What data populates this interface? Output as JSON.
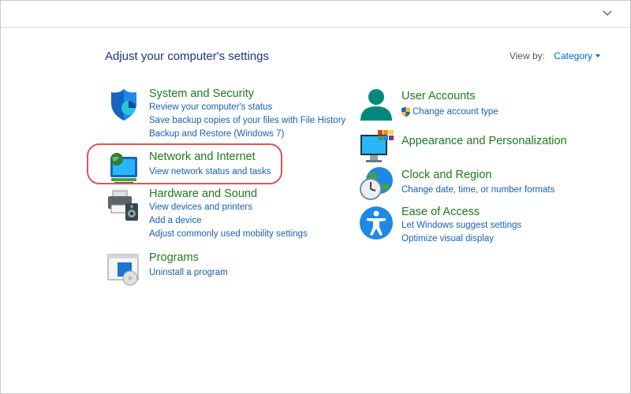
{
  "window": {
    "heading": "Adjust your computer's settings",
    "view_by_label": "View by:",
    "view_by_value": "Category",
    "dropdown_icon": "chevron-down-icon"
  },
  "left_column": [
    {
      "title": "System and Security",
      "icon": "shield-icon",
      "links": [
        "Review your computer's status",
        "Save backup copies of your files with File History",
        "Backup and Restore (Windows 7)"
      ]
    },
    {
      "title": "Network and Internet",
      "icon": "network-globe-icon",
      "highlighted": true,
      "links": [
        "View network status and tasks"
      ]
    },
    {
      "title": "Hardware and Sound",
      "icon": "printer-speaker-icon",
      "links": [
        "View devices and printers",
        "Add a device",
        "Adjust commonly used mobility settings"
      ]
    },
    {
      "title": "Programs",
      "icon": "programs-disc-icon",
      "links": [
        "Uninstall a program"
      ]
    }
  ],
  "right_column": [
    {
      "title": "User Accounts",
      "icon": "user-icon",
      "links": [
        "Change account type"
      ],
      "link_icon": "uac-shield-icon"
    },
    {
      "title": "Appearance and Personalization",
      "icon": "monitor-palette-icon",
      "links": []
    },
    {
      "title": "Clock and Region",
      "icon": "clock-globe-icon",
      "links": [
        "Change date, time, or number formats"
      ]
    },
    {
      "title": "Ease of Access",
      "icon": "accessibility-icon",
      "links": [
        "Let Windows suggest settings",
        "Optimize visual display"
      ]
    }
  ],
  "colors": {
    "heading": "#1e3287",
    "category_title": "#1f7a1f",
    "link": "#1a5fb4",
    "highlight_border": "#e0535a"
  }
}
